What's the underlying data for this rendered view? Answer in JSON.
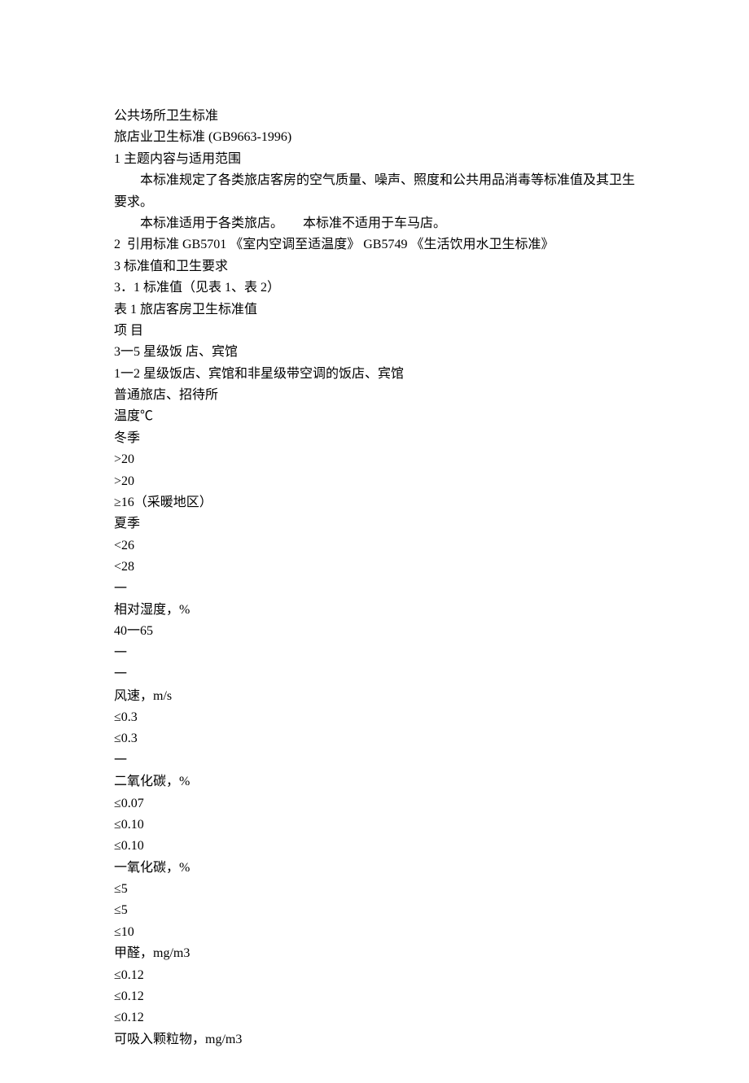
{
  "doc": {
    "title_main": "公共场所卫生标准",
    "title_sub": "旅店业卫生标准 (GB9663-1996)",
    "sec1_heading": "1 主题内容与适用范围",
    "sec1_p1": "本标准规定了各类旅店客房的空气质量、噪声、照度和公共用品消毒等标准值及其卫生要求。",
    "sec1_p2": "本标准适用于各类旅店。　　本标准不适用于车马店。",
    "sec2_line": "2  引用标准 GB5701 《室内空调至适温度》 GB5749 《生活饮用水卫生标准》",
    "sec3_heading": "3 标准值和卫生要求",
    "sec3_1": "3．1 标准值（见表 1、表 2）",
    "table1_title": "表 1 旅店客房卫生标准值",
    "item_label": "项 目",
    "col1": "3一5 星级饭 店、宾馆",
    "col2": "1一2 星级饭店、宾馆和非星级带空调的饭店、宾馆",
    "col3": "普通旅店、招待所",
    "temp_label": "温度℃",
    "winter": "冬季",
    "winter_v1": ">20",
    "winter_v2": ">20",
    "winter_v3": "≥16（采暖地区）",
    "summer": "夏季",
    "summer_v1": "<26",
    "summer_v2": "<28",
    "summer_v3": "一",
    "rh_label": "相对湿度，%",
    "rh_v1": "40一65",
    "rh_v2": "一",
    "rh_v3": "一",
    "wind_label": "风速，m/s",
    "wind_v1": "≤0.3",
    "wind_v2": "≤0.3",
    "wind_v3": "一",
    "co2_label": "二氧化碳，%",
    "co2_v1": "≤0.07",
    "co2_v2": "≤0.10",
    "co2_v3": "≤0.10",
    "co_label": "一氧化碳，%",
    "co_v1": "≤5",
    "co_v2": "≤5",
    "co_v3": "≤10",
    "hcho_label": "甲醛，mg/m3",
    "hcho_v1": "≤0.12",
    "hcho_v2": "≤0.12",
    "hcho_v3": "≤0.12",
    "pm_label": "可吸入颗粒物，mg/m3"
  }
}
